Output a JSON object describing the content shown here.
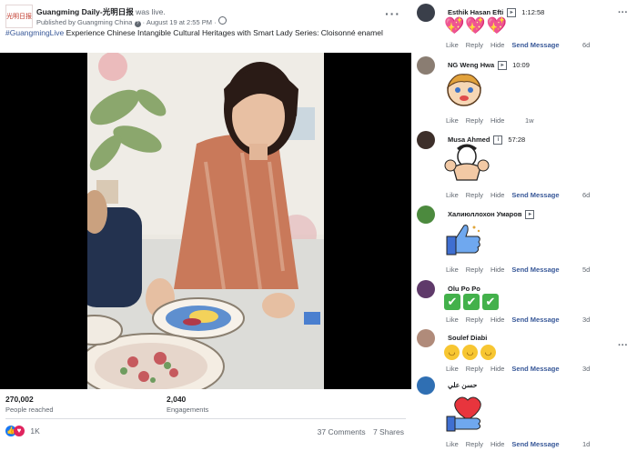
{
  "post": {
    "avatar_text": "光明日报",
    "page_name": "Guangming Daily-光明日报",
    "was_live": "was live.",
    "published_by": "Published by Guangming China",
    "date": "August 19 at 2:55 PM",
    "hashtag": "#GuangmingLive",
    "text": " Experience Chinese Intangible Cultural Heritages with Smart Lady Series: Cloisonné enamel",
    "people_reached_value": "270,002",
    "people_reached_label": "People reached",
    "engagements_value": "2,040",
    "engagements_label": "Engagements",
    "reaction_count": "1K",
    "comments_count": "37 Comments",
    "shares_count": "7 Shares"
  },
  "comments": [
    {
      "name": "Esthik Hasan Efti",
      "time": "1:12:58",
      "content": "hearts",
      "age": "6d",
      "like": "Like",
      "reply": "Reply",
      "hide": "Hide",
      "send": "Send Message"
    },
    {
      "name": "NG Weng Hwa",
      "time": "10:09",
      "content": "sticker-girl",
      "age": "1w",
      "like": "Like",
      "reply": "Reply",
      "hide": "Hide",
      "send": ""
    },
    {
      "name": "Musa Ahmed",
      "time": "57:28",
      "content": "sticker-muscle",
      "age": "6d",
      "like": "Like",
      "reply": "Reply",
      "hide": "Hide",
      "send": "Send Message"
    },
    {
      "name": "Халиюллохон Умаров",
      "time": "",
      "content": "thumbs-up",
      "age": "5d",
      "like": "Like",
      "reply": "Reply",
      "hide": "Hide",
      "send": "Send Message"
    },
    {
      "name": "Olu Po Po",
      "time": "",
      "content": "checks",
      "age": "3d",
      "like": "Like",
      "reply": "Reply",
      "hide": "Hide",
      "send": "Send Message"
    },
    {
      "name": "Soulef Diabi",
      "time": "",
      "content": "laughs",
      "age": "3d",
      "like": "Like",
      "reply": "Reply",
      "hide": "Hide",
      "send": "Send Message"
    },
    {
      "name": "حسن علي",
      "time": "",
      "content": "heart-hand",
      "age": "1d",
      "like": "Like",
      "reply": "Reply",
      "hide": "Hide",
      "send": "Send Message"
    }
  ],
  "colors": {
    "link": "#385898",
    "accent_like": "#1877f2",
    "love": "#e0245e"
  }
}
